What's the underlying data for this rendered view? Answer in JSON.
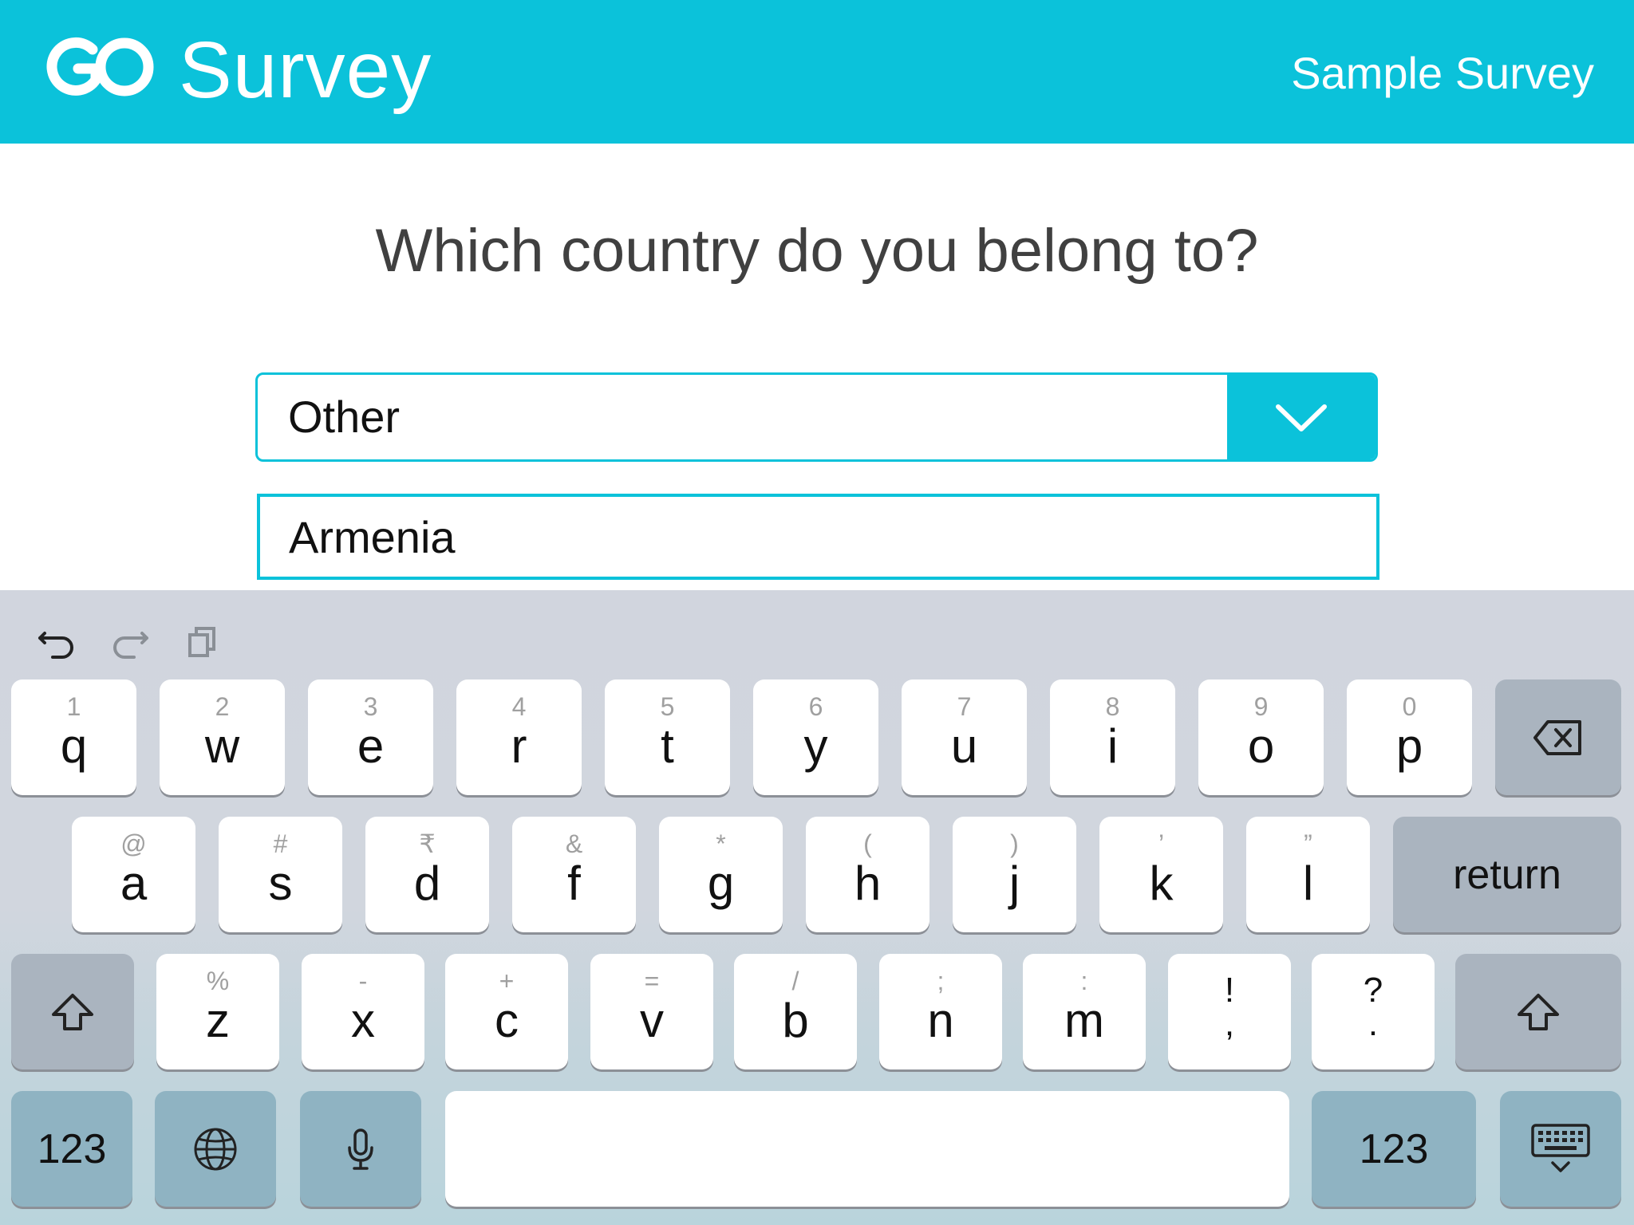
{
  "header": {
    "brand": "Survey",
    "survey_title": "Sample Survey",
    "logo_icon": "go-logo-icon",
    "background_color": "#0bc2da"
  },
  "question": {
    "text": "Which country do you belong to?"
  },
  "country_select": {
    "selected": "Other",
    "icon": "chevron-down-icon"
  },
  "other_input": {
    "value": "Armenia"
  },
  "keyboard": {
    "shortcuts": [
      "undo-icon",
      "redo-icon",
      "paste-icon"
    ],
    "row1": [
      {
        "hint": "1",
        "key": "q"
      },
      {
        "hint": "2",
        "key": "w"
      },
      {
        "hint": "3",
        "key": "e"
      },
      {
        "hint": "4",
        "key": "r"
      },
      {
        "hint": "5",
        "key": "t"
      },
      {
        "hint": "6",
        "key": "y"
      },
      {
        "hint": "7",
        "key": "u"
      },
      {
        "hint": "8",
        "key": "i"
      },
      {
        "hint": "9",
        "key": "o"
      },
      {
        "hint": "0",
        "key": "p"
      }
    ],
    "row2": [
      {
        "hint": "@",
        "key": "a"
      },
      {
        "hint": "#",
        "key": "s"
      },
      {
        "hint": "₹",
        "key": "d"
      },
      {
        "hint": "&",
        "key": "f"
      },
      {
        "hint": "*",
        "key": "g"
      },
      {
        "hint": "(",
        "key": "h"
      },
      {
        "hint": ")",
        "key": "j"
      },
      {
        "hint": "’",
        "key": "k"
      },
      {
        "hint": "”",
        "key": "l"
      }
    ],
    "row3": [
      {
        "hint": "%",
        "key": "z"
      },
      {
        "hint": "-",
        "key": "x"
      },
      {
        "hint": "+",
        "key": "c"
      },
      {
        "hint": "=",
        "key": "v"
      },
      {
        "hint": "/",
        "key": "b"
      },
      {
        "hint": ";",
        "key": "n"
      },
      {
        "hint": ":",
        "key": "m"
      }
    ],
    "punct1": {
      "top": "!",
      "bottom": ","
    },
    "punct2": {
      "top": "?",
      "bottom": "."
    },
    "return_label": "return",
    "numbers_label": "123",
    "numbers_label_right": "123"
  }
}
